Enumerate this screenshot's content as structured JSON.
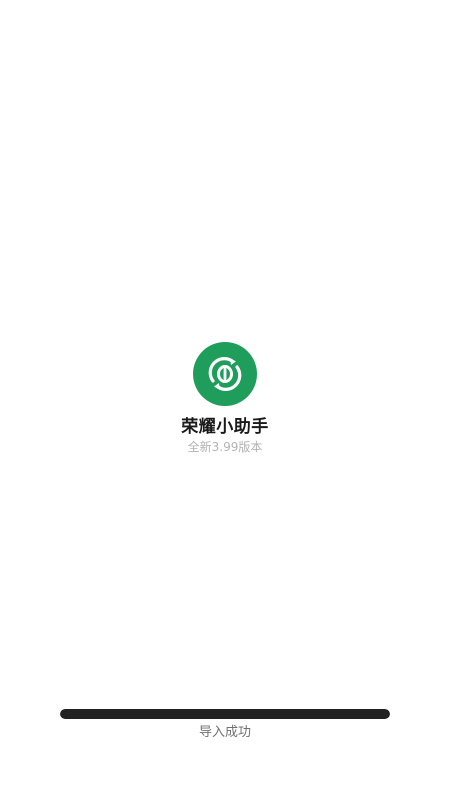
{
  "app": {
    "name": "荣耀小助手",
    "version_text": "全新3.99版本",
    "logo_icon": "sync-arrows-icon",
    "brand_color": "#1e9e5a"
  },
  "progress": {
    "percent": 100,
    "bar_color": "#222222",
    "status_text": "导入成功"
  }
}
